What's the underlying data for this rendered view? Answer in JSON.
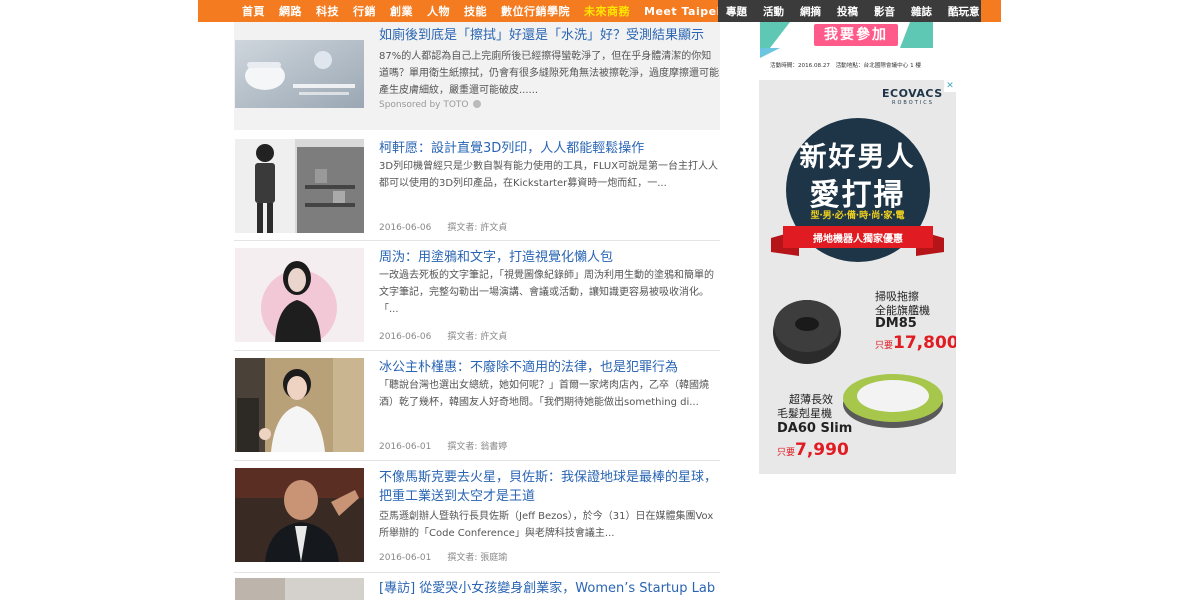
{
  "nav": {
    "left": [
      "首頁",
      "網路",
      "科技",
      "行銷",
      "創業",
      "人物",
      "技能",
      "數位行銷學院",
      "未來商務",
      "Meet Taipei"
    ],
    "right": [
      "專題",
      "活動",
      "網摘",
      "投稿",
      "影音",
      "雜誌",
      "酷玩意"
    ]
  },
  "articles": [
    {
      "title": "如廁後到底是「擦拭」好還是「水洗」好？受測結果顯示",
      "summary": "87%的人都認為自己上完廁所後已經擦得蠻乾淨了，但在乎身體清潔的你知道嗎？單用衛生紙擦拭，仍會有很多縫隙死角無法被擦乾淨，過度摩擦還可能產生皮膚細紋，嚴重還可能破皮......",
      "sponsor": "Sponsored by TOTO"
    },
    {
      "title": "柯軒愿：設計直覺3D列印，人人都能輕鬆操作",
      "summary": "3D列印機曾經只是少數自製有能力使用的工具，FLUX可說是第一台主打人人都可以使用的3D列印產品，在Kickstarter募資時一炮而紅，一...",
      "date": "2016-06-06",
      "author": "撰文者: 許文貞"
    },
    {
      "title": "周沩：用塗鴉和文字，打造視覺化懶人包",
      "summary": "一改過去死板的文字筆記，「視覺圖像紀錄師」周沩利用生動的塗鴉和簡單的文字筆記，完整勾勒出一場演講、會議或活動，讓知識更容易被吸收消化。「...",
      "date": "2016-06-06",
      "author": "撰文者: 許文貞"
    },
    {
      "title": "冰公主朴槿惠：不廢除不適用的法律，也是犯罪行為",
      "summary": "「聽說台灣也選出女總統，她如何呢？」首爾一家烤肉店內，乙卒（韓國燒酒）乾了幾杯，韓國友人好奇地問。「我們期待她能做出something di...",
      "date": "2016-06-01",
      "author": "撰文者: 翁書婷"
    },
    {
      "title": "不像馬斯克要去火星，貝佐斯：我保證地球是最棒的星球，把重工業送到太空才是王道",
      "summary": "亞馬遜創辦人暨執行長貝佐斯（Jeff Bezos），於今（31）日在媒體集團Vox所舉辦的「Code Conference」與老牌科技會議主...",
      "date": "2016-06-01",
      "author": "撰文者: 張庭瑜"
    },
    {
      "title": "[專訪] 從愛哭小女孩變身創業家，Women’s Startup Lab"
    }
  ],
  "ad_top": {
    "cta": "我要參加",
    "date_line": "活動時間：2016.08.27　活動地點：台北國際會議中心 1 樓"
  },
  "ad_main": {
    "brand": "ECOVACS",
    "brand_sub": "ROBOTICS",
    "headline_1": "新好男人",
    "headline_2": "愛打掃",
    "tagline": "型‧男‧必‧備‧時‧尚‧家‧電",
    "ribbon": "掃地機器人獨家優惠",
    "p1_desc_1": "掃吸拖擦",
    "p1_desc_2": "全能旗艦機",
    "p1_model": "DM85",
    "p1_price_prefix": "只要",
    "p1_price": "17,800",
    "p2_desc_1": "超薄長效",
    "p2_desc_2": "毛髮剋星機",
    "p2_model": "DA60 Slim",
    "p2_price_prefix": "只要",
    "p2_price": "7,990"
  },
  "colors": {
    "nav_orange": "#f47b20",
    "nav_dark": "#3b3b3b",
    "nav_highlight": "#ffe600",
    "link_blue": "#2a65b3",
    "ad_navy": "#1d3547",
    "ad_red": "#e11b22",
    "ad_teal": "#49c3b1"
  }
}
